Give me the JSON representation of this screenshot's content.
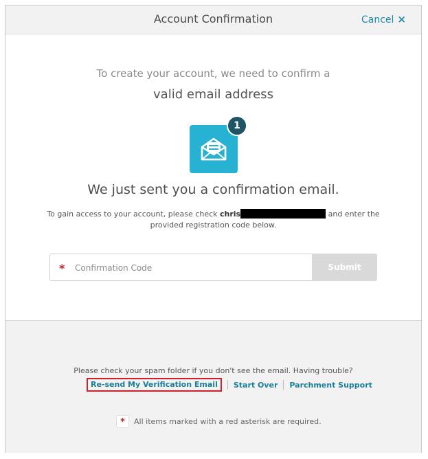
{
  "header": {
    "title": "Account Confirmation",
    "cancel_label": "Cancel",
    "cancel_icon": "×"
  },
  "intro": {
    "line1": "To create your account, we need to confirm a",
    "line2": "valid email address"
  },
  "notification_badge": "1",
  "sent_heading": "We just sent you a confirmation email.",
  "gain_access": {
    "before": "To gain access to your account, please check ",
    "email_visible": "chris",
    "after": " and enter the provided registration code below."
  },
  "form": {
    "asterisk": "*",
    "code_placeholder": "Confirmation Code",
    "code_value": "",
    "submit_label": "Submit"
  },
  "footer": {
    "spam_text": "Please check your spam folder if you don't see the email. Having trouble?",
    "links": {
      "resend": "Re-send My Verification Email",
      "start_over": "Start Over",
      "support": "Parchment Support"
    },
    "required_asterisk": "*",
    "required_note": "All items marked with a red asterisk are required."
  },
  "colors": {
    "accent": "#1a8aa6",
    "envelope_tile": "#27b2d3",
    "badge": "#1f5566",
    "required": "#c0282d",
    "submit_disabled": "#d9d9d9"
  },
  "icons": {
    "envelope": "open-envelope-icon",
    "close": "close-icon"
  }
}
